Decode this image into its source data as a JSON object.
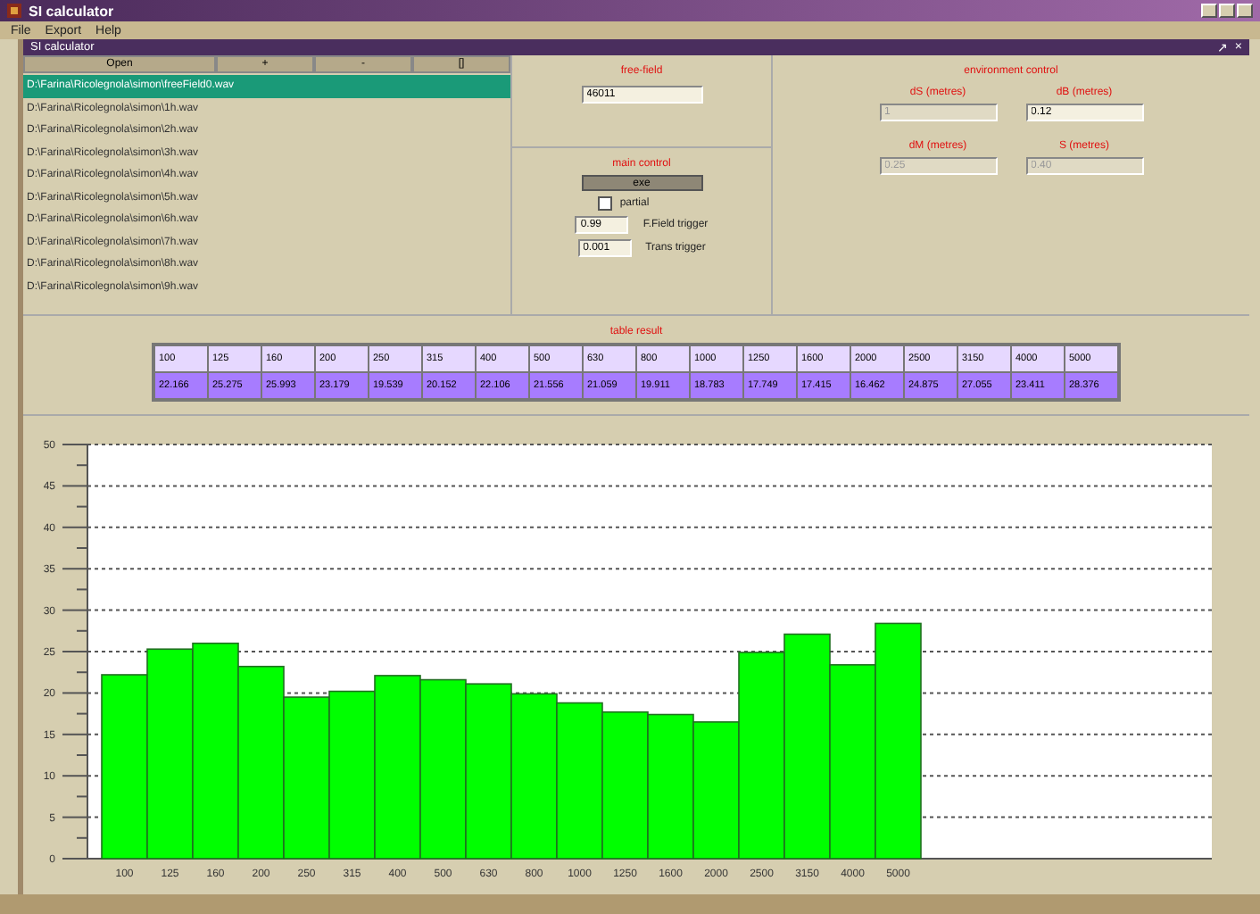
{
  "window": {
    "title": "SI calculator"
  },
  "menu": [
    "File",
    "Export",
    "Help"
  ],
  "inner_window": {
    "title": "SI calculator",
    "buttons": [
      "↗",
      "×"
    ]
  },
  "file_panel": {
    "buttons": [
      "Open",
      "+",
      "-",
      "[]"
    ],
    "files": [
      {
        "label": "D:\\Farina\\Ricolegnola\\simon\\freeField0.wav",
        "selected": true
      },
      {
        "label": "D:\\Farina\\Ricolegnola\\simon\\1h.wav",
        "selected": false
      },
      {
        "label": "D:\\Farina\\Ricolegnola\\simon\\2h.wav",
        "selected": false
      },
      {
        "label": "D:\\Farina\\Ricolegnola\\simon\\3h.wav",
        "selected": false
      },
      {
        "label": "D:\\Farina\\Ricolegnola\\simon\\4h.wav",
        "selected": false
      },
      {
        "label": "D:\\Farina\\Ricolegnola\\simon\\5h.wav",
        "selected": false
      },
      {
        "label": "D:\\Farina\\Ricolegnola\\simon\\6h.wav",
        "selected": false
      },
      {
        "label": "D:\\Farina\\Ricolegnola\\simon\\7h.wav",
        "selected": false
      },
      {
        "label": "D:\\Farina\\Ricolegnola\\simon\\8h.wav",
        "selected": false
      },
      {
        "label": "D:\\Farina\\Ricolegnola\\simon\\9h.wav",
        "selected": false
      }
    ]
  },
  "free_field": {
    "title": "free-field",
    "value": "46011"
  },
  "main_control": {
    "title": "main control",
    "button": "exe",
    "partial": {
      "label": "partial",
      "checked": false
    },
    "triggers": [
      {
        "value": "0.99",
        "label": "F.Field trigger"
      },
      {
        "value": "0.001",
        "label": "Trans trigger"
      }
    ]
  },
  "environment_control": {
    "title": "environment control",
    "fields": [
      {
        "label": "dS (metres)",
        "value": "1",
        "disabled": true
      },
      {
        "label": "dB (metres)",
        "value": "0.12",
        "disabled": false
      },
      {
        "label": "dM (metres)",
        "value": "0.25",
        "disabled": true
      },
      {
        "label": "S (metres)",
        "value": "0.40",
        "disabled": true
      }
    ]
  },
  "table_result": {
    "title": "table result",
    "columns": [
      "100",
      "125",
      "160",
      "200",
      "250",
      "315",
      "400",
      "500",
      "630",
      "800",
      "1000",
      "1250",
      "1600",
      "2000",
      "2500",
      "3150",
      "4000",
      "5000"
    ],
    "values": [
      "22.166",
      "25.275",
      "25.993",
      "23.179",
      "19.539",
      "20.152",
      "22.106",
      "21.556",
      "21.059",
      "19.911",
      "18.783",
      "17.749",
      "17.415",
      "16.462",
      "24.875",
      "27.055",
      "23.411",
      "28.376"
    ]
  },
  "chart": {
    "chart_data": {
      "type": "bar",
      "categories": [
        "100",
        "125",
        "160",
        "200",
        "250",
        "315",
        "400",
        "500",
        "630",
        "800",
        "1000",
        "1250",
        "1600",
        "2000",
        "2500",
        "3150",
        "4000",
        "5000"
      ],
      "series": [
        {
          "color": "#00ff00",
          "values": [
            22.2,
            25.3,
            26.0,
            23.2,
            19.5,
            20.2,
            22.1,
            21.6,
            21.1,
            19.9,
            18.8,
            17.7,
            17.4,
            16.5,
            24.9,
            27.1,
            23.4,
            28.4
          ]
        }
      ],
      "grid": true,
      "ylim": [
        0,
        50
      ],
      "yticks": [
        0,
        5,
        10,
        15,
        20,
        25,
        30,
        35,
        40,
        45,
        50
      ]
    }
  }
}
